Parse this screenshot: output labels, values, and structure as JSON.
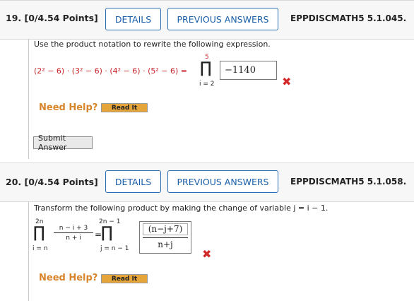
{
  "q19": {
    "number": "19.",
    "points": "[0/4.54 Points]",
    "details_label": "DETAILS",
    "prev_label": "PREVIOUS ANSWERS",
    "code": "EPPDISCMATH5 5.1.045.",
    "instruction": "Use the product notation to rewrite the following expression.",
    "expression": "(2² − 6) · (3² − 6) · (4² − 6) · (5² − 6) =",
    "pi_upper": "5",
    "pi_lower": "i = 2",
    "answer": "−1140",
    "need_help": "Need Help?",
    "read_it": "Read It",
    "submit": "Submit Answer"
  },
  "q20": {
    "number": "20.",
    "points": "[0/4.54 Points]",
    "details_label": "DETAILS",
    "prev_label": "PREVIOUS ANSWERS",
    "code": "EPPDISCMATH5 5.1.058.",
    "instruction": "Transform the following product by making the change of variable j = i − 1.",
    "left_upper": "2n",
    "left_lower": "i = n",
    "frac_num": "n − i + 3",
    "frac_den": "n + i",
    "equals": "=",
    "right_upper": "2n − 1",
    "right_lower": "j = n − 1",
    "answer_num": "(n−j+7)",
    "answer_den": "n+j",
    "need_help": "Need Help?",
    "read_it": "Read It"
  },
  "icons": {
    "wrong": "✖",
    "product": "∏"
  },
  "colors": {
    "accent": "#2a6db5",
    "error": "#d22a2a",
    "help": "#d8842a",
    "readit": "#e6a53b"
  }
}
